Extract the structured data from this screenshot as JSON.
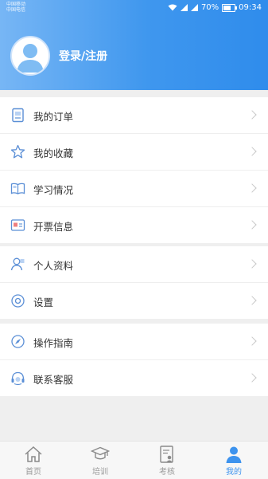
{
  "status_bar": {
    "carrier_line1": "中国移动",
    "carrier_line2": "中国电信",
    "battery": "70%",
    "time": "09:34"
  },
  "profile": {
    "login_label": "登录/注册"
  },
  "menu_groups": [
    {
      "items": [
        {
          "label": "我的订单",
          "icon": "order-icon"
        },
        {
          "label": "我的收藏",
          "icon": "star-icon"
        },
        {
          "label": "学习情况",
          "icon": "book-icon"
        },
        {
          "label": "开票信息",
          "icon": "invoice-icon"
        }
      ]
    },
    {
      "items": [
        {
          "label": "个人资料",
          "icon": "person-icon"
        },
        {
          "label": "设置",
          "icon": "settings-icon"
        }
      ]
    },
    {
      "items": [
        {
          "label": "操作指南",
          "icon": "compass-icon"
        },
        {
          "label": "联系客服",
          "icon": "headset-icon"
        }
      ]
    }
  ],
  "tabbar": {
    "tabs": [
      {
        "label": "首页",
        "icon": "home-icon"
      },
      {
        "label": "培训",
        "icon": "graduation-cap-icon"
      },
      {
        "label": "考核",
        "icon": "exam-icon"
      },
      {
        "label": "我的",
        "icon": "user-icon"
      }
    ],
    "active_color": "#3d93ee"
  },
  "colors": {
    "header_start": "#77b6f5",
    "header_end": "#2f8cec",
    "icon_blue": "#5b8fd6"
  }
}
